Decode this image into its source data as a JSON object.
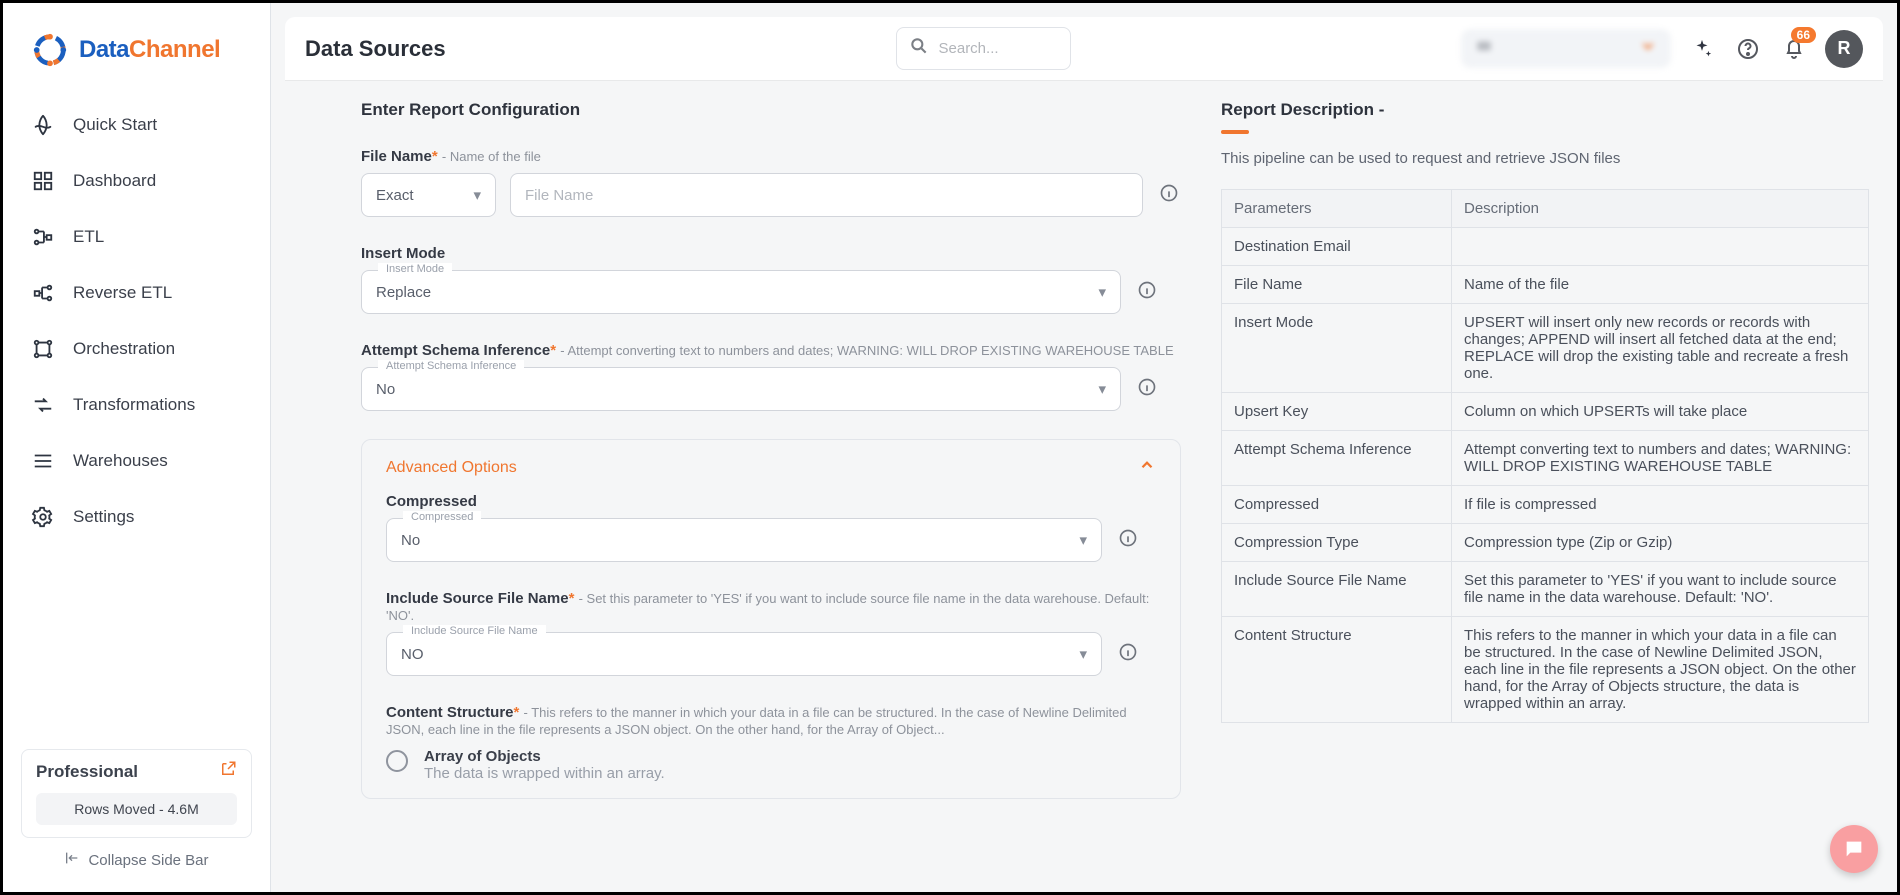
{
  "brand": {
    "name1": "Data",
    "name2": "Channel"
  },
  "nav": {
    "items": [
      {
        "label": "Quick Start"
      },
      {
        "label": "Dashboard"
      },
      {
        "label": "ETL"
      },
      {
        "label": "Reverse ETL"
      },
      {
        "label": "Orchestration"
      },
      {
        "label": "Transformations"
      },
      {
        "label": "Warehouses"
      },
      {
        "label": "Settings"
      }
    ]
  },
  "plan": {
    "name": "Professional",
    "rows_label": "Rows Moved - 4.6M"
  },
  "collapse_label": "Collapse Side Bar",
  "topbar": {
    "title": "Data Sources",
    "search_placeholder": "Search...",
    "endpoint": "",
    "badge": "66",
    "avatar": "R"
  },
  "form": {
    "section_title": "Enter Report Configuration",
    "file_name": {
      "label": "File Name",
      "hint": "- Name of the file",
      "match_mode": "Exact",
      "placeholder": "File Name"
    },
    "insert_mode": {
      "label": "Insert Mode",
      "float": "Insert Mode",
      "value": "Replace"
    },
    "schema_inf": {
      "label": "Attempt Schema Inference",
      "hint": "- Attempt converting text to numbers and dates; WARNING: WILL DROP EXISTING WAREHOUSE TABLE",
      "float": "Attempt Schema Inference",
      "value": "No"
    },
    "advanced_title": "Advanced Options",
    "compressed": {
      "label": "Compressed",
      "float": "Compressed",
      "value": "No"
    },
    "include_src": {
      "label": "Include Source File Name",
      "hint": "- Set this parameter to 'YES' if you want to include source file name in the data warehouse. Default: 'NO'.",
      "float": "Include Source File Name",
      "value": "NO"
    },
    "content_structure": {
      "label": "Content Structure",
      "hint": "- This refers to the manner in which your data in a file can be structured. In the case of Newline Delimited JSON, each line in the file represents a JSON object. On the other hand, for the Array of Object...",
      "opt_title": "Array of Objects",
      "opt_sub": "The data is wrapped within an array."
    }
  },
  "desc": {
    "title": "Report Description -",
    "text": "This pipeline can be used to request and retrieve JSON files",
    "head_param": "Parameters",
    "head_desc": "Description",
    "rows": [
      {
        "k": "Destination Email",
        "v": ""
      },
      {
        "k": "File Name",
        "v": "Name of the file"
      },
      {
        "k": "Insert Mode",
        "v": "UPSERT will insert only new records or records with changes; APPEND will insert all fetched data at the end; REPLACE will drop the existing table and recreate a fresh one."
      },
      {
        "k": "Upsert Key",
        "v": "Column on which UPSERTs will take place"
      },
      {
        "k": "Attempt Schema Inference",
        "v": "Attempt converting text to numbers and dates; WARNING: WILL DROP EXISTING WAREHOUSE TABLE"
      },
      {
        "k": "Compressed",
        "v": "If file is compressed"
      },
      {
        "k": "Compression Type",
        "v": "Compression type (Zip or Gzip)"
      },
      {
        "k": "Include Source File Name",
        "v": "Set this parameter to 'YES' if you want to include source file name in the data warehouse. Default: 'NO'."
      },
      {
        "k": "Content Structure",
        "v": "This refers to the manner in which your data in a file can be structured. In the case of Newline Delimited JSON, each line in the file represents a JSON object. On the other hand, for the Array of Objects structure, the data is wrapped within an array."
      }
    ]
  }
}
